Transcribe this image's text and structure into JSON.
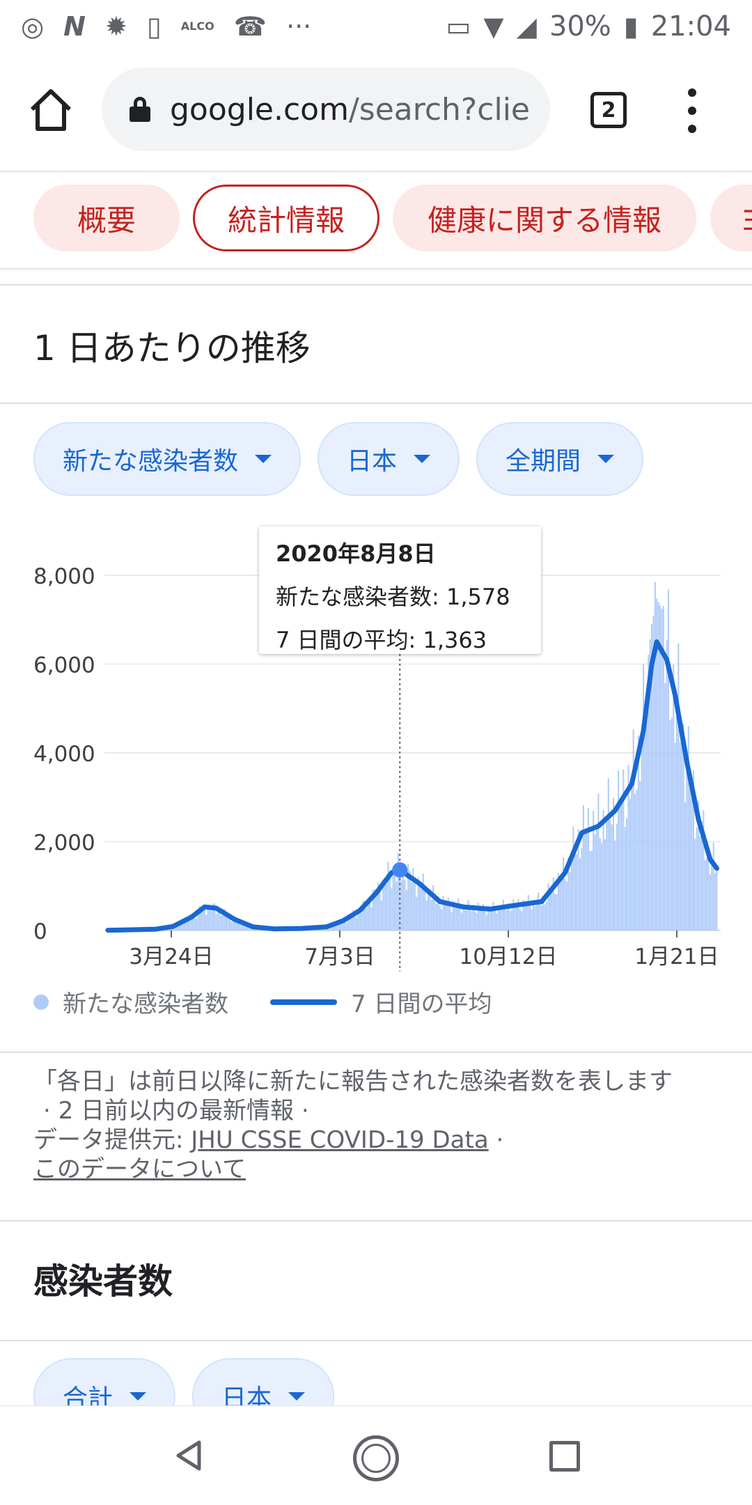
{
  "status_bar": {
    "battery": "30%",
    "time": "21:04",
    "alco": "ALCO",
    "overflow": "···",
    "left_icons": [
      "chrome-icon",
      "n-icon",
      "brightness-icon",
      "battery-saver-icon",
      "alco-icon",
      "call-icon",
      "more-icon"
    ],
    "right_icons": [
      "nfc-icon",
      "wifi-icon",
      "signal-icon",
      "battery-icon"
    ]
  },
  "browser": {
    "url_host": "google.com",
    "url_rest": "/search?clie",
    "tab_count": "2"
  },
  "topic_chips": [
    {
      "label": "概要",
      "active": false
    },
    {
      "label": "統計情報",
      "active": true
    },
    {
      "label": "健康に関する情報",
      "active": false
    },
    {
      "label": "ヨ",
      "active": false
    }
  ],
  "section": {
    "title": "1 日あたりの推移"
  },
  "filters": {
    "metric": "新たな感染者数",
    "region": "日本",
    "period": "全期間"
  },
  "tooltip": {
    "date": "2020年8月8日",
    "new_cases": "新たな感染者数: 1,578",
    "avg": "7 日間の平均: 1,363"
  },
  "legend": {
    "daily": "新たな感染者数",
    "avg": "7 日間の平均"
  },
  "notes": {
    "line1": "「各日」は前日以降に新たに報告された感染者数を表します",
    "line2": "· 2 日前以内の最新情報 ·",
    "source_label": "データ提供元:",
    "source_link": "JHU CSSE COVID-19 Data",
    "sep": "·",
    "about_link": "このデータについて"
  },
  "section2": {
    "title": "感染者数",
    "filter1": "合計",
    "filter2": "日本"
  },
  "colors": {
    "accent_red": "#c5221f",
    "chip_red_bg": "#fce8e6",
    "accent_blue": "#1967d2",
    "bar_blue": "#aecbfa",
    "chip_blue_bg": "#e8f0fe"
  },
  "chart_data": {
    "type": "bar",
    "ylim": [
      0,
      8000
    ],
    "yticks": [
      0,
      2000,
      4000,
      6000,
      8000
    ],
    "ytick_labels": [
      "0",
      "2,000",
      "4,000",
      "6,000",
      "8,000"
    ],
    "xtick_labels": [
      "3月24日",
      "7月3日",
      "10月12日",
      "1月21日"
    ],
    "x_start": "2020-02-15",
    "xtick_dates": [
      "2020-03-24",
      "2020-07-03",
      "2020-10-12",
      "2021-01-21"
    ],
    "highlight": {
      "date": "2020-08-08",
      "new_cases": 1578,
      "avg": 1363
    },
    "grid": true,
    "series": [
      {
        "name": "7 日間の平均",
        "kind": "line",
        "points": [
          [
            "2020-02-15",
            5
          ],
          [
            "2020-03-01",
            15
          ],
          [
            "2020-03-15",
            30
          ],
          [
            "2020-03-25",
            90
          ],
          [
            "2020-04-05",
            300
          ],
          [
            "2020-04-13",
            530
          ],
          [
            "2020-04-20",
            500
          ],
          [
            "2020-05-01",
            250
          ],
          [
            "2020-05-12",
            80
          ],
          [
            "2020-05-25",
            35
          ],
          [
            "2020-06-10",
            45
          ],
          [
            "2020-06-25",
            80
          ],
          [
            "2020-07-05",
            220
          ],
          [
            "2020-07-15",
            450
          ],
          [
            "2020-07-25",
            850
          ],
          [
            "2020-08-03",
            1300
          ],
          [
            "2020-08-08",
            1363
          ],
          [
            "2020-08-20",
            1050
          ],
          [
            "2020-09-01",
            650
          ],
          [
            "2020-09-15",
            530
          ],
          [
            "2020-10-01",
            480
          ],
          [
            "2020-10-15",
            560
          ],
          [
            "2020-11-01",
            650
          ],
          [
            "2020-11-15",
            1300
          ],
          [
            "2020-11-25",
            2200
          ],
          [
            "2020-12-05",
            2350
          ],
          [
            "2020-12-15",
            2700
          ],
          [
            "2020-12-25",
            3300
          ],
          [
            "2021-01-01",
            4500
          ],
          [
            "2021-01-06",
            6000
          ],
          [
            "2021-01-09",
            6500
          ],
          [
            "2021-01-15",
            6100
          ],
          [
            "2021-01-20",
            5300
          ],
          [
            "2021-01-27",
            3800
          ],
          [
            "2021-02-03",
            2500
          ],
          [
            "2021-02-10",
            1600
          ],
          [
            "2021-02-14",
            1400
          ]
        ]
      },
      {
        "name": "新たな感染者数",
        "kind": "bar",
        "peak": {
          "date": "2021-01-08",
          "value": 7850
        },
        "values_follow_avg_with_daily_variation": true
      }
    ]
  }
}
